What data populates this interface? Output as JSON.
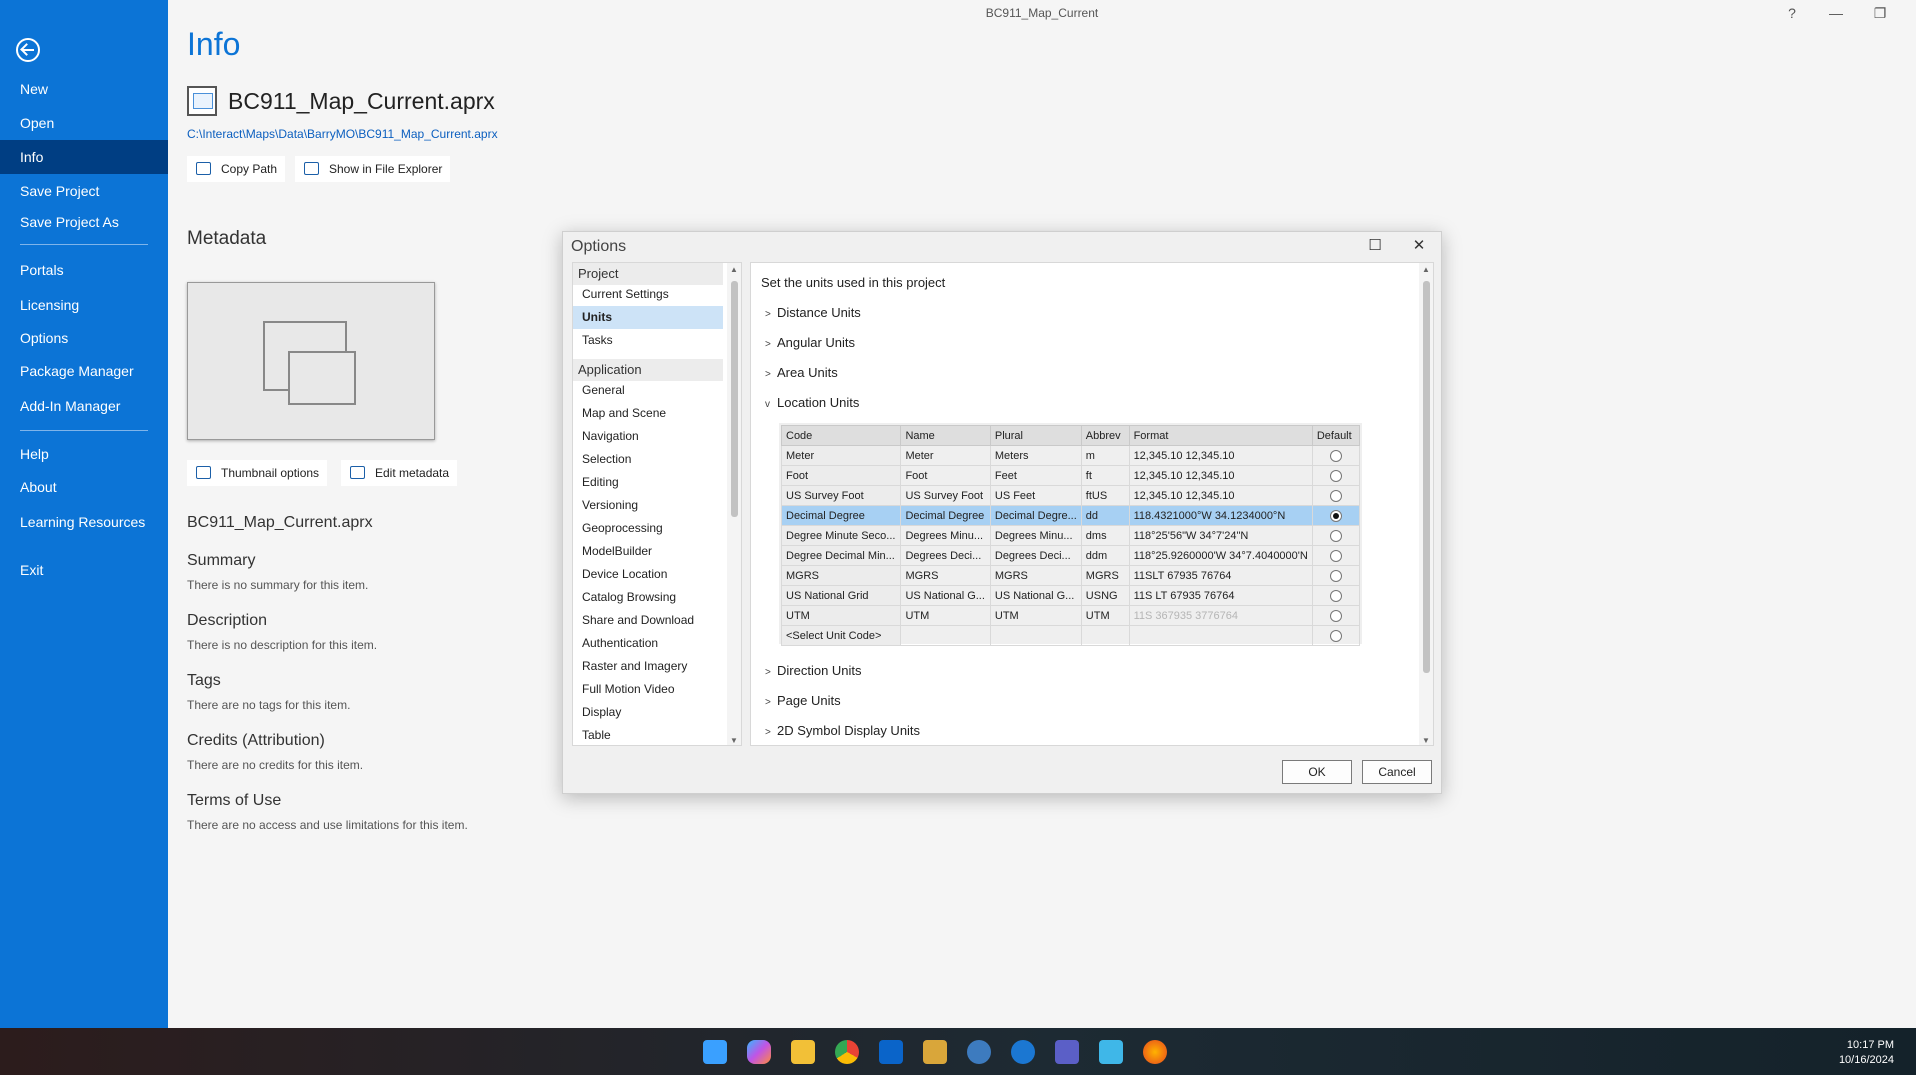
{
  "window": {
    "title": "BC911_Map_Current",
    "help_icon": "?",
    "minimize_icon": "—",
    "restore_icon": "❐",
    "close_icon": "✕"
  },
  "sidebar": {
    "items": [
      {
        "label": "New"
      },
      {
        "label": "Open"
      },
      {
        "label": "Info"
      },
      {
        "label": "Save Project"
      },
      {
        "label": "Save Project As"
      },
      {
        "label": "Portals"
      },
      {
        "label": "Licensing"
      },
      {
        "label": "Options"
      },
      {
        "label": "Package Manager"
      },
      {
        "label": "Add-In Manager"
      },
      {
        "label": "Help"
      },
      {
        "label": "About"
      },
      {
        "label": "Learning Resources"
      },
      {
        "label": "Exit"
      }
    ],
    "active": "Info"
  },
  "main": {
    "heading": "Info",
    "file_name": "BC911_Map_Current.aprx",
    "file_path": "C:\\Interact\\Maps\\Data\\BarryMO\\BC911_Map_Current.aprx",
    "copy_path": "Copy Path",
    "show_explorer": "Show in File Explorer",
    "metadata_heading": "Metadata",
    "thumbnail_options": "Thumbnail options",
    "edit_metadata": "Edit metadata",
    "item_name": "BC911_Map_Current.aprx",
    "sections": [
      {
        "label": "Summary",
        "text": "There is no summary for this item."
      },
      {
        "label": "Description",
        "text": "There is no description for this item."
      },
      {
        "label": "Tags",
        "text": "There are no tags for this item."
      },
      {
        "label": "Credits (Attribution)",
        "text": "There are no credits for this item."
      },
      {
        "label": "Terms of Use",
        "text": "There are no access and use limitations for this item."
      }
    ]
  },
  "dialog": {
    "title": "Options",
    "maximize_icon": "☐",
    "close_icon": "✕",
    "nav": {
      "group_project": "Project",
      "project_items": [
        "Current Settings",
        "Units",
        "Tasks"
      ],
      "group_application": "Application",
      "application_items": [
        "General",
        "Map and Scene",
        "Navigation",
        "Selection",
        "Editing",
        "Versioning",
        "Geoprocessing",
        "ModelBuilder",
        "Device Location",
        "Catalog Browsing",
        "Share and Download",
        "Authentication",
        "Raster and Imagery",
        "Full Motion Video",
        "Display",
        "Table"
      ],
      "selected": "Units"
    },
    "content": {
      "heading": "Set the units used in this project",
      "sections_top": [
        "Distance Units",
        "Angular Units",
        "Area Units"
      ],
      "expanded": "Location Units",
      "sections_bottom": [
        "Direction Units",
        "Page Units",
        "2D Symbol Display Units"
      ],
      "table": {
        "headers": [
          "Code",
          "Name",
          "Plural",
          "Abbrev",
          "Format",
          "Default"
        ],
        "rows": [
          {
            "code": "Meter",
            "name": "Meter",
            "plural": "Meters",
            "abbrev": "m",
            "format": "12,345.10 12,345.10",
            "default": false
          },
          {
            "code": "Foot",
            "name": "Foot",
            "plural": "Feet",
            "abbrev": "ft",
            "format": "12,345.10 12,345.10",
            "default": false
          },
          {
            "code": "US Survey Foot",
            "name": "US Survey Foot",
            "plural": "US Feet",
            "abbrev": "ftUS",
            "format": "12,345.10 12,345.10",
            "default": false
          },
          {
            "code": "Decimal Degree",
            "name": "Decimal Degree",
            "plural": "Decimal Degre...",
            "abbrev": "dd",
            "format": "118.4321000°W 34.1234000°N",
            "default": true
          },
          {
            "code": "Degree Minute Seco...",
            "name": "Degrees Minu...",
            "plural": "Degrees Minu...",
            "abbrev": "dms",
            "format": "118°25'56\"W 34°7'24\"N",
            "default": false
          },
          {
            "code": "Degree Decimal Min...",
            "name": "Degrees Deci...",
            "plural": "Degrees Deci...",
            "abbrev": "ddm",
            "format": "118°25.9260000'W 34°7.4040000'N",
            "default": false
          },
          {
            "code": "MGRS",
            "name": "MGRS",
            "plural": "MGRS",
            "abbrev": "MGRS",
            "format": "11SLT 67935 76764",
            "default": false
          },
          {
            "code": "US National Grid",
            "name": "US National G...",
            "plural": "US National G...",
            "abbrev": "USNG",
            "format": "11S LT 67935 76764",
            "default": false
          },
          {
            "code": "UTM",
            "name": "UTM",
            "plural": "UTM",
            "abbrev": "UTM",
            "format": "11S 367935 3776764",
            "default": false
          },
          {
            "code": "<Select Unit Code>",
            "name": "",
            "plural": "",
            "abbrev": "",
            "format": "",
            "default": false
          }
        ]
      }
    },
    "ok": "OK",
    "cancel": "Cancel"
  },
  "taskbar": {
    "time": "10:17 PM",
    "date": "10/16/2024"
  }
}
